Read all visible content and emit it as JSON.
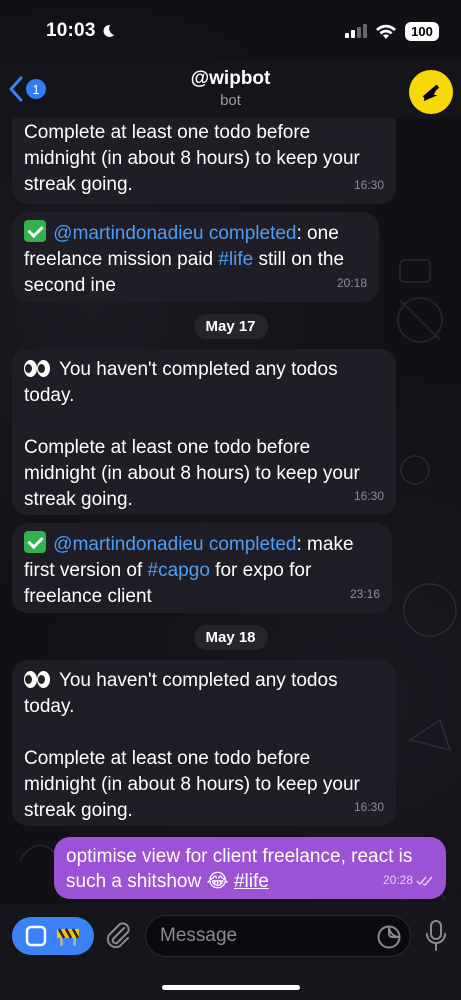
{
  "status": {
    "time": "10:03",
    "battery": "100"
  },
  "header": {
    "back_count": "1",
    "title": "@wipbot",
    "subtitle": "bot"
  },
  "messages": [
    {
      "lines_after": "Complete at least one todo before midnight (in about 8 hours) to keep your streak going.",
      "time": "16:30"
    },
    {
      "mention": "@martindonadieu",
      "action": "completed",
      "text_a": ": one freelance mission paid ",
      "hashtag": "#life",
      "text_b": " still on the second ine",
      "time": "20:18"
    },
    {
      "date": "May 17"
    },
    {
      "line1": "You haven't completed any todos today.",
      "line2": "Complete at least one todo before midnight (in about 8 hours) to keep your streak going.",
      "time": "16:30"
    },
    {
      "mention": "@martindonadieu",
      "action": "completed",
      "text_a": ": make first version of ",
      "hashtag": "#capgo",
      "text_b": " for expo for freelance client",
      "time": "23:16"
    },
    {
      "date": "May 18"
    },
    {
      "line1": "You haven't completed any todos today.",
      "line2": "Complete at least one todo before midnight (in about 8 hours) to keep your streak going.",
      "time": "16:30"
    }
  ],
  "outgoing": {
    "text": "optimise view for client freelance, react is such a shitshow 😂 ",
    "hashtag": "#life",
    "time": "20:28"
  },
  "input": {
    "placeholder": "Message"
  },
  "colors": {
    "accent": "#3b82f6",
    "outgoing_bubble": "#9b52d4",
    "avatar": "#f8d80b"
  }
}
